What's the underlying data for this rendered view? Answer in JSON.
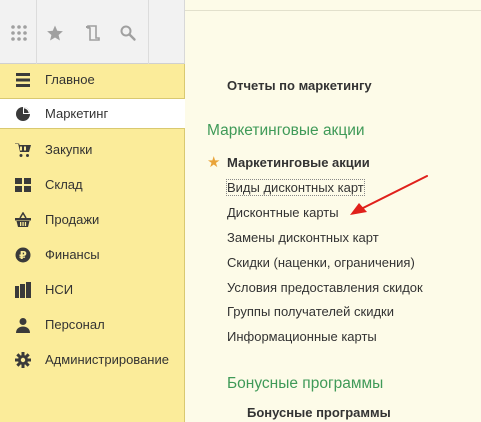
{
  "nav": {
    "items": [
      {
        "label": "Главное",
        "icon": "menu-lines-icon"
      },
      {
        "label": "Маркетинг",
        "icon": "pie-chart-icon"
      },
      {
        "label": "Закупки",
        "icon": "cart-icon"
      },
      {
        "label": "Склад",
        "icon": "warehouse-grid-icon"
      },
      {
        "label": "Продажи",
        "icon": "basket-icon"
      },
      {
        "label": "Финансы",
        "icon": "ruble-coin-icon"
      },
      {
        "label": "НСИ",
        "icon": "documents-icon"
      },
      {
        "label": "Персонал",
        "icon": "person-icon"
      },
      {
        "label": "Администрирование",
        "icon": "gear-icon"
      }
    ],
    "active": "Маркетинг"
  },
  "toolbar": {
    "icons": [
      "apps-grid-icon",
      "star-icon",
      "history-icon",
      "search-icon"
    ]
  },
  "content": {
    "reports_link": "Отчеты по маркетингу",
    "section1": {
      "title": "Маркетинговые акции",
      "starred_item": "Маркетинговые акции",
      "links": [
        "Виды дисконтных карт",
        "Дисконтные карты",
        "Замены дисконтных карт",
        "Скидки (наценки, ограничения)",
        "Условия предоставления скидок",
        "Группы получателей скидки",
        "Информационные карты"
      ]
    },
    "section2": {
      "title": "Бонусные программы",
      "bold_item": "Бонусные программы"
    }
  },
  "colors": {
    "sidebar_bg": "#fbec9a",
    "content_bg": "#fdfbe8",
    "section_title": "#3f9a58",
    "star": "#e9a43a",
    "annotation_arrow": "#e0201b"
  }
}
